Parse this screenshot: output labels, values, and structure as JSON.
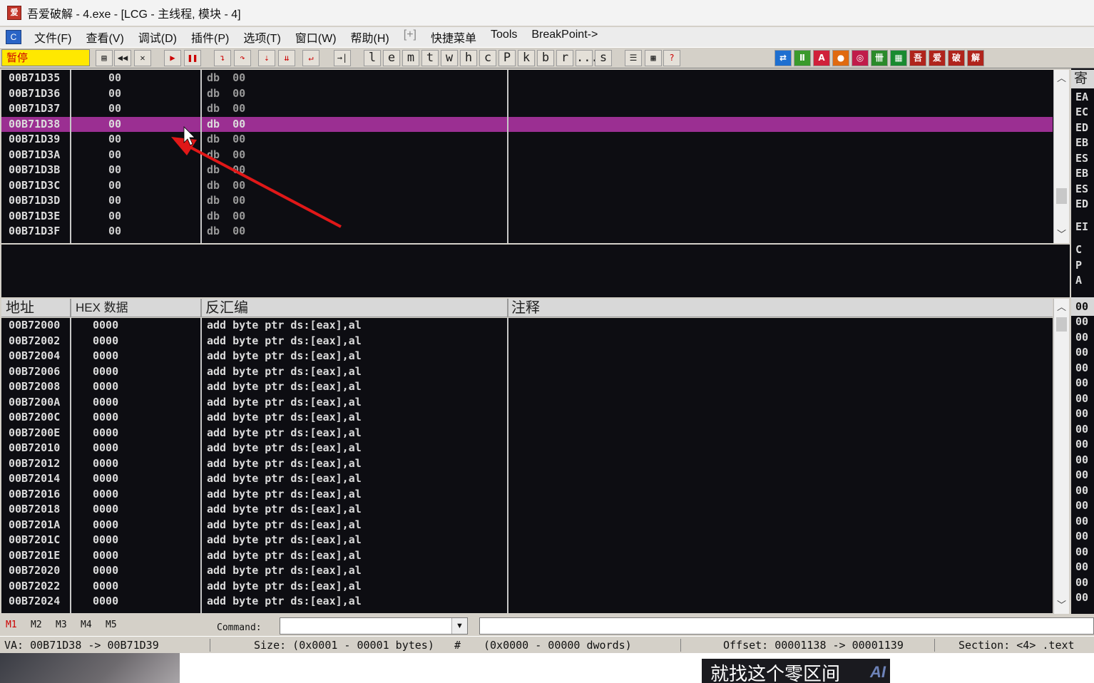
{
  "window": {
    "title": "吾爱破解 - 4.exe - [LCG -  主线程, 模块 - 4]",
    "icon": "app-icon"
  },
  "menu": [
    {
      "label": "文件(F)"
    },
    {
      "label": "查看(V)"
    },
    {
      "label": "调试(D)"
    },
    {
      "label": "插件(P)"
    },
    {
      "label": "选项(T)"
    },
    {
      "label": "窗口(W)"
    },
    {
      "label": "帮助(H)"
    },
    {
      "label": "[+]"
    },
    {
      "label": "快捷菜单"
    },
    {
      "label": "Tools"
    },
    {
      "label": "BreakPoint->"
    }
  ],
  "toolbar": {
    "status": "暂停",
    "letters": [
      "l",
      "e",
      "m",
      "t",
      "w",
      "h",
      "c",
      "P",
      "k",
      "b",
      "r",
      "...",
      "s"
    ],
    "icons": [
      "open-icon",
      "restart-icon",
      "close-icon",
      "run-icon",
      "pause-icon",
      "step-into-icon",
      "step-over-icon",
      "trace-into-icon",
      "trace-over-icon",
      "execute-till-return-icon",
      "goto-icon",
      "list-icon",
      "grid-icon",
      "help-icon"
    ],
    "plugin_icons": [
      {
        "label": "⇄",
        "color": "#1e6fd0"
      },
      {
        "label": "Ⅱ",
        "color": "#3a9a2c"
      },
      {
        "label": "A",
        "color": "#d0203a"
      },
      {
        "label": "●",
        "color": "#e06a10"
      },
      {
        "label": "◎",
        "color": "#c01c4a"
      },
      {
        "label": "卌",
        "color": "#2a8a2a"
      },
      {
        "label": "▦",
        "color": "#198a30"
      },
      {
        "label": "吾",
        "color": "#b0241c"
      },
      {
        "label": "爱",
        "color": "#b0241c"
      },
      {
        "label": "破",
        "color": "#b0241c"
      },
      {
        "label": "解",
        "color": "#b0241c"
      }
    ]
  },
  "top_pane": {
    "rows": [
      {
        "addr": "00B71D35",
        "hex": "00",
        "dis": "db  00"
      },
      {
        "addr": "00B71D36",
        "hex": "00",
        "dis": "db  00"
      },
      {
        "addr": "00B71D37",
        "hex": "00",
        "dis": "db  00"
      },
      {
        "addr": "00B71D38",
        "hex": "00",
        "dis": "db  00",
        "selected": true
      },
      {
        "addr": "00B71D39",
        "hex": "00",
        "dis": "db  00"
      },
      {
        "addr": "00B71D3A",
        "hex": "00",
        "dis": "db  00"
      },
      {
        "addr": "00B71D3B",
        "hex": "00",
        "dis": "db  00"
      },
      {
        "addr": "00B71D3C",
        "hex": "00",
        "dis": "db  00"
      },
      {
        "addr": "00B71D3D",
        "hex": "00",
        "dis": "db  00"
      },
      {
        "addr": "00B71D3E",
        "hex": "00",
        "dis": "db  00"
      },
      {
        "addr": "00B71D3F",
        "hex": "00",
        "dis": "db  00"
      }
    ]
  },
  "main_pane": {
    "headers": {
      "addr": "地址",
      "hex": "HEX 数据",
      "dis": "反汇编",
      "comment": "注释"
    },
    "rows": [
      {
        "addr": "00B72000",
        "hex": "0000",
        "dis": "add byte ptr ds:[eax],al"
      },
      {
        "addr": "00B72002",
        "hex": "0000",
        "dis": "add byte ptr ds:[eax],al"
      },
      {
        "addr": "00B72004",
        "hex": "0000",
        "dis": "add byte ptr ds:[eax],al"
      },
      {
        "addr": "00B72006",
        "hex": "0000",
        "dis": "add byte ptr ds:[eax],al"
      },
      {
        "addr": "00B72008",
        "hex": "0000",
        "dis": "add byte ptr ds:[eax],al"
      },
      {
        "addr": "00B7200A",
        "hex": "0000",
        "dis": "add byte ptr ds:[eax],al"
      },
      {
        "addr": "00B7200C",
        "hex": "0000",
        "dis": "add byte ptr ds:[eax],al"
      },
      {
        "addr": "00B7200E",
        "hex": "0000",
        "dis": "add byte ptr ds:[eax],al"
      },
      {
        "addr": "00B72010",
        "hex": "0000",
        "dis": "add byte ptr ds:[eax],al"
      },
      {
        "addr": "00B72012",
        "hex": "0000",
        "dis": "add byte ptr ds:[eax],al"
      },
      {
        "addr": "00B72014",
        "hex": "0000",
        "dis": "add byte ptr ds:[eax],al"
      },
      {
        "addr": "00B72016",
        "hex": "0000",
        "dis": "add byte ptr ds:[eax],al"
      },
      {
        "addr": "00B72018",
        "hex": "0000",
        "dis": "add byte ptr ds:[eax],al"
      },
      {
        "addr": "00B7201A",
        "hex": "0000",
        "dis": "add byte ptr ds:[eax],al"
      },
      {
        "addr": "00B7201C",
        "hex": "0000",
        "dis": "add byte ptr ds:[eax],al"
      },
      {
        "addr": "00B7201E",
        "hex": "0000",
        "dis": "add byte ptr ds:[eax],al"
      },
      {
        "addr": "00B72020",
        "hex": "0000",
        "dis": "add byte ptr ds:[eax],al"
      },
      {
        "addr": "00B72022",
        "hex": "0000",
        "dis": "add byte ptr ds:[eax],al"
      },
      {
        "addr": "00B72024",
        "hex": "0000",
        "dis": "add byte ptr ds:[eax],al"
      }
    ]
  },
  "registers": {
    "header": "寄",
    "top": [
      {
        "label": "EA"
      },
      {
        "label": "EC"
      },
      {
        "label": "ED"
      },
      {
        "label": "EB"
      },
      {
        "label": "ES"
      },
      {
        "label": "EB"
      },
      {
        "label": "ES"
      },
      {
        "label": "ED"
      },
      {
        "label": "EI"
      },
      {
        "label": "C"
      },
      {
        "label": "P"
      },
      {
        "label": "A"
      }
    ],
    "stack_header": "00",
    "stack": [
      "00",
      "00",
      "00",
      "00",
      "00",
      "00",
      "00",
      "00",
      "00",
      "00",
      "00",
      "00",
      "00",
      "00",
      "00",
      "00",
      "00",
      "00",
      "00"
    ]
  },
  "dump_tabs": [
    "M1",
    "M2",
    "M3",
    "M4",
    "M5"
  ],
  "command": {
    "label": "Command:",
    "value": ""
  },
  "status": {
    "va": "VA: 00B71D38 -> 00B71D39",
    "size": "Size: (0x0001 - 00001 bytes)",
    "hash": "#",
    "dwords": "(0x0000 - 00000 dwords)",
    "offset": "Offset: 00001138 -> 00001139",
    "section": "Section: <4> .text"
  },
  "overlay": {
    "caption": "就找这个零区间",
    "mark": "AI"
  },
  "colors": {
    "selection": "#9b2f92",
    "paused": "#ffe800",
    "arrow": "#e01818"
  }
}
